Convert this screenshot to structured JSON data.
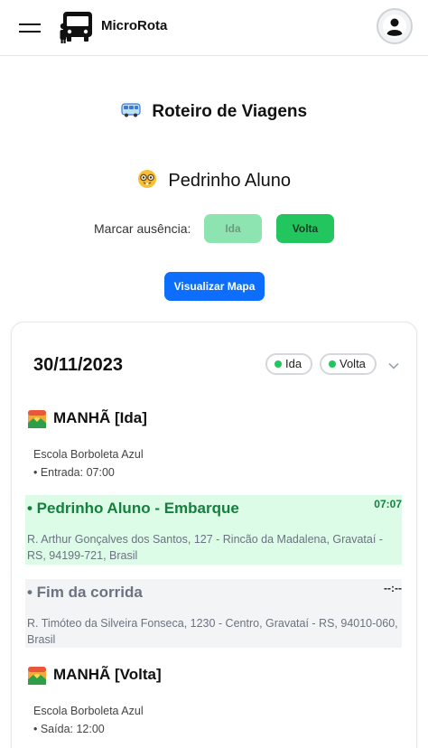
{
  "app": {
    "brand": "MicroRota"
  },
  "page": {
    "title": "Roteiro de Viagens",
    "student_name": "Pedrinho Aluno",
    "absence_label": "Marcar ausência:",
    "absence_buttons": {
      "ida": "Ida",
      "volta": "Volta"
    },
    "map_button": "Visualizar Mapa"
  },
  "trip": {
    "date": "30/11/2023",
    "badges": {
      "ida": "Ida",
      "volta": "Volta"
    },
    "sections": [
      {
        "title": "MANHÃ [Ida]",
        "school": "Escola Borboleta Azul",
        "time_note": "• Entrada: 07:00",
        "stops": [
          {
            "title": "• Pedrinho Aluno - Embarque",
            "time": "07:07",
            "address": "R. Arthur Gonçalves dos Santos, 127 - Rincão da Madalena, Gravataí - RS, 94199-721, Brasil"
          },
          {
            "title": "• Fim da corrida",
            "time": "--:--",
            "address": "R. Timóteo da Silveira Fonseca, 1230 - Centro, Gravataí - RS, 94010-060, Brasil"
          }
        ]
      },
      {
        "title": "MANHÃ [Volta]",
        "school": "Escola Borboleta Azul",
        "time_note": "• Saída: 12:00"
      }
    ]
  },
  "colors": {
    "primary_blue": "#0d6efd",
    "green": "#22c55e",
    "green_light": "#8ee4b1",
    "boarding_bg": "#dcfce7",
    "boarding_text": "#15803d",
    "end_bg": "#f3f4f6"
  },
  "icons": {
    "menu": "hamburger-menu-icon",
    "logo": "bus-logo-icon",
    "user": "user-avatar-icon",
    "title": "bus-emoji-icon",
    "student": "nerd-face-emoji-icon",
    "section": "sunrise-emoji-icon",
    "expand": "chevron-down-icon"
  }
}
